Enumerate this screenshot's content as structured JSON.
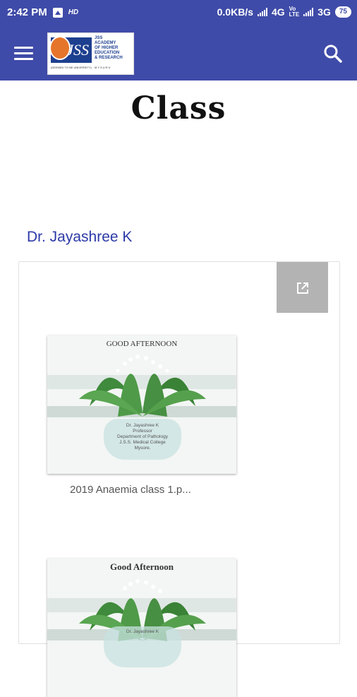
{
  "status_bar": {
    "time": "2:42 PM",
    "hd": "HD",
    "speed": "0.0KB/s",
    "net1": "4G",
    "volte_top": "Vo",
    "volte_bottom": "LTE",
    "net2": "3G",
    "battery": "75"
  },
  "app_bar": {
    "menu_icon": "menu-icon",
    "search_icon": "search-icon",
    "logo": {
      "mark": "JSS",
      "lines": [
        "JSS",
        "ACADEMY",
        "OF HIGHER",
        "EDUCATION",
        "& RESEARCH"
      ],
      "tagline": "(DEEMED TO BE UNIVERSITY)",
      "city": "MYSURU"
    }
  },
  "page": {
    "title": "Class",
    "author": "Dr. Jayashree K"
  },
  "card": {
    "open_icon": "open-in-new-icon",
    "items": [
      {
        "greeting": "GOOD  AFTERNOON",
        "caption": "2019 Anaemia class 1.p...",
        "slide_lines": [
          "Dr. Jayashree K",
          "Professor",
          "Department of Pathology",
          "J.S.S. Medical College",
          "Mysore."
        ]
      },
      {
        "greeting": "Good Afternoon",
        "slide_lines": [
          "Dr. Jayashree K"
        ]
      }
    ]
  },
  "colors": {
    "primary": "#3f4ba8",
    "author_text": "#2d3aa8",
    "open_button": "#b3b3b3"
  }
}
